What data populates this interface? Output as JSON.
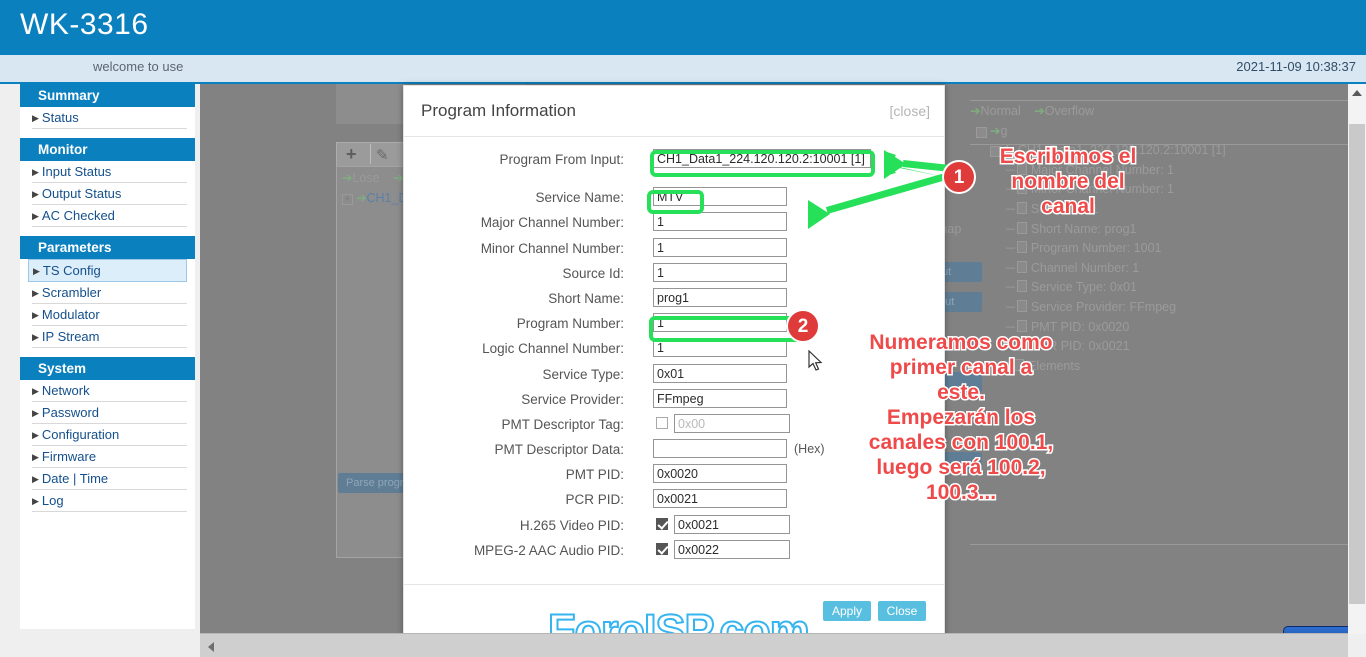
{
  "header": {
    "brand": "WK-3316",
    "welcome": "welcome to use",
    "datetime": "2021-11-09 10:38:37"
  },
  "sidebar": {
    "sections": [
      {
        "title": "Summary",
        "items": [
          {
            "label": "Status"
          }
        ]
      },
      {
        "title": "Monitor",
        "items": [
          {
            "label": "Input Status"
          },
          {
            "label": "Output Status"
          },
          {
            "label": "AC Checked"
          }
        ]
      },
      {
        "title": "Parameters",
        "items": [
          {
            "label": "TS Config",
            "active": true
          },
          {
            "label": "Scrambler"
          },
          {
            "label": "Modulator"
          },
          {
            "label": "IP Stream"
          }
        ]
      },
      {
        "title": "System",
        "items": [
          {
            "label": "Network"
          },
          {
            "label": "Password"
          },
          {
            "label": "Configuration"
          },
          {
            "label": "Firmware"
          },
          {
            "label": "Date | Time"
          },
          {
            "label": "Log"
          }
        ]
      }
    ]
  },
  "background": {
    "legend_lose": "Lose",
    "legend_normal": "Normal",
    "legend_overflow": "Overflow",
    "tree_item_input": "CH1_D",
    "parse_button": "Parse progr",
    "pid_map": "map",
    "btn_input": "put",
    "btn_output": "tput",
    "tree": {
      "root": "g",
      "program": "1:  CH1_Data1_224.120.120.2:10001 [1]",
      "nodes": [
        "Major Channel Number: 1",
        "Minor Channel Number: 1",
        "Source Id: 1",
        "Short Name: prog1",
        "Program Number: 1001",
        "Channel Number: 1",
        "Service Type: 0x01",
        "Service Provider: FFmpeg",
        "PMT PID: 0x0020",
        "PCR PID: 0x0021"
      ],
      "elements": "Elements"
    }
  },
  "dialog": {
    "title": "Program Information",
    "close_link": "[close]",
    "hex_note": "(Hex)",
    "fields": [
      {
        "label": "Program From Input:",
        "value": "CH1_Data1_224.120.120.2:10001 [1]",
        "wide": true
      },
      {
        "label": "Service Name:",
        "value": "MTV"
      },
      {
        "label": "Major Channel Number:",
        "value": "1"
      },
      {
        "label": "Minor Channel Number:",
        "value": "1"
      },
      {
        "label": "Source Id:",
        "value": "1"
      },
      {
        "label": "Short Name:",
        "value": "prog1"
      },
      {
        "label": "Program Number:",
        "value": "1"
      },
      {
        "label": "Logic Channel Number:",
        "value": "1"
      },
      {
        "label": "Service Type:",
        "value": "0x01"
      },
      {
        "label": "Service Provider:",
        "value": "FFmpeg"
      },
      {
        "label": "PMT Descriptor Tag:",
        "value": "",
        "placeholder": "0x00",
        "checkbox": "off"
      },
      {
        "label": "PMT Descriptor Data:",
        "value": "",
        "hex": true
      },
      {
        "label": "PMT PID:",
        "value": "0x0020"
      },
      {
        "label": "PCR PID:",
        "value": "0x0021"
      },
      {
        "label": "H.265 Video PID:",
        "value": "0x0021",
        "checkbox": "on"
      },
      {
        "label": "MPEG-2 AAC Audio PID:",
        "value": "0x0022",
        "checkbox": "on"
      }
    ],
    "apply_label": "Apply",
    "close_label": "Close"
  },
  "annotations": {
    "badge1": "1",
    "badge2": "2",
    "text1": "Escribimos el\nnombre del\ncanal",
    "text2": "Numeramos como\nprimer canal a\neste.\nEmpezarán los\ncanales con 100.1,\nluego será 100.2,\n100.3...",
    "highlight_color": "#27e05a",
    "badge_color": "#e03b3b",
    "text_color": "#ef4a4a"
  },
  "watermark": {
    "main": "ForoISP.com",
    "badge": "ForoISP"
  }
}
